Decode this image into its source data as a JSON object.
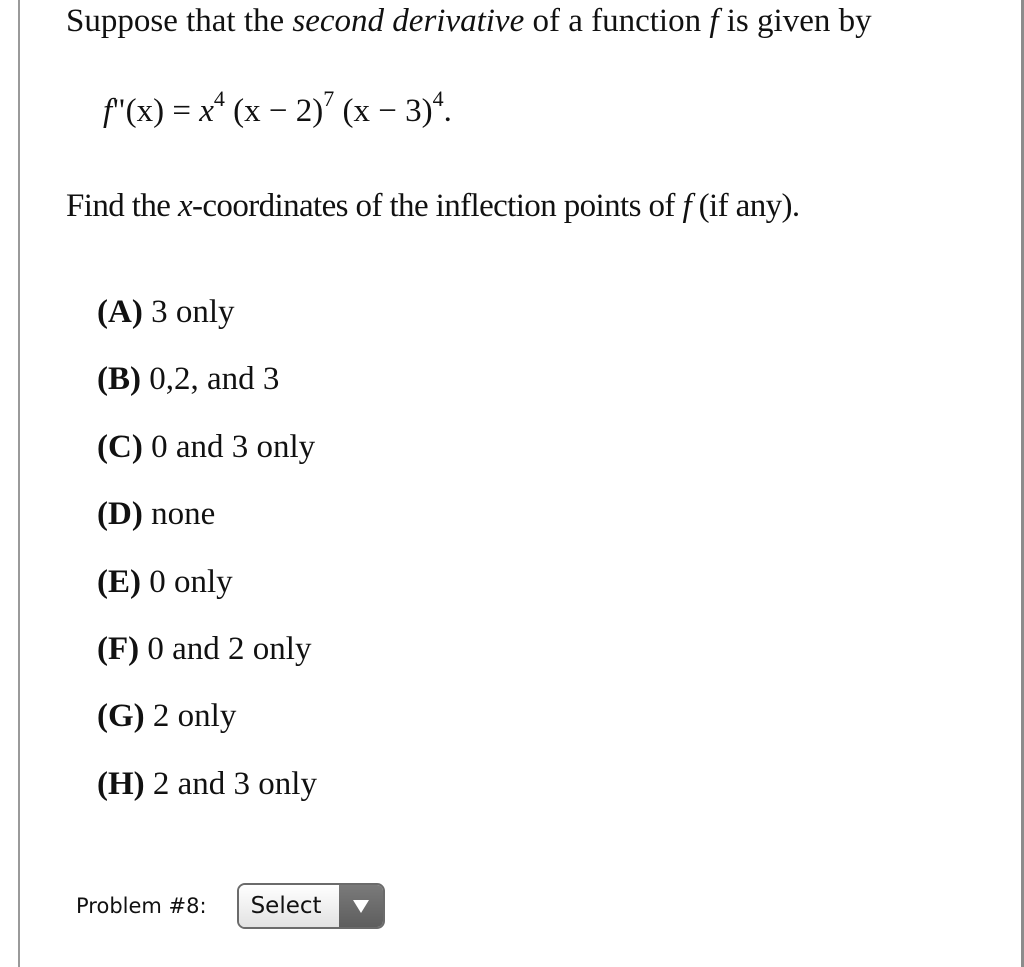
{
  "problem": {
    "intro": {
      "before": "Suppose that the ",
      "emphasis": "second derivative",
      "middle": " of a function ",
      "func": "f",
      "after": " is given by"
    },
    "formula": {
      "lhs_func": "f",
      "lhs_rest": "\"(x) = ",
      "terms": [
        {
          "base": "x",
          "exponent": "4"
        },
        {
          "base": "(x − 2)",
          "exponent": "7"
        },
        {
          "base": "(x − 3)",
          "exponent": "4"
        }
      ],
      "end": "."
    },
    "question": {
      "before": "Find the ",
      "var": "x",
      "middle": "-coordinates of the inflection points of ",
      "func": "f",
      "after": " (if any)."
    },
    "options": [
      {
        "letter": "(A)",
        "text": " 3 only"
      },
      {
        "letter": "(B)",
        "text": " 0,2, and 3"
      },
      {
        "letter": "(C)",
        "text": " 0 and 3 only"
      },
      {
        "letter": "(D)",
        "text": " none"
      },
      {
        "letter": "(E)",
        "text": " 0 only"
      },
      {
        "letter": "(F)",
        "text": " 0 and 2 only"
      },
      {
        "letter": "(G)",
        "text": " 2 only"
      },
      {
        "letter": "(H)",
        "text": " 2 and 3 only"
      }
    ]
  },
  "answer": {
    "label": "Problem #8:",
    "select_value": "Select",
    "arrow_icon": "dropdown-triangle-icon"
  }
}
